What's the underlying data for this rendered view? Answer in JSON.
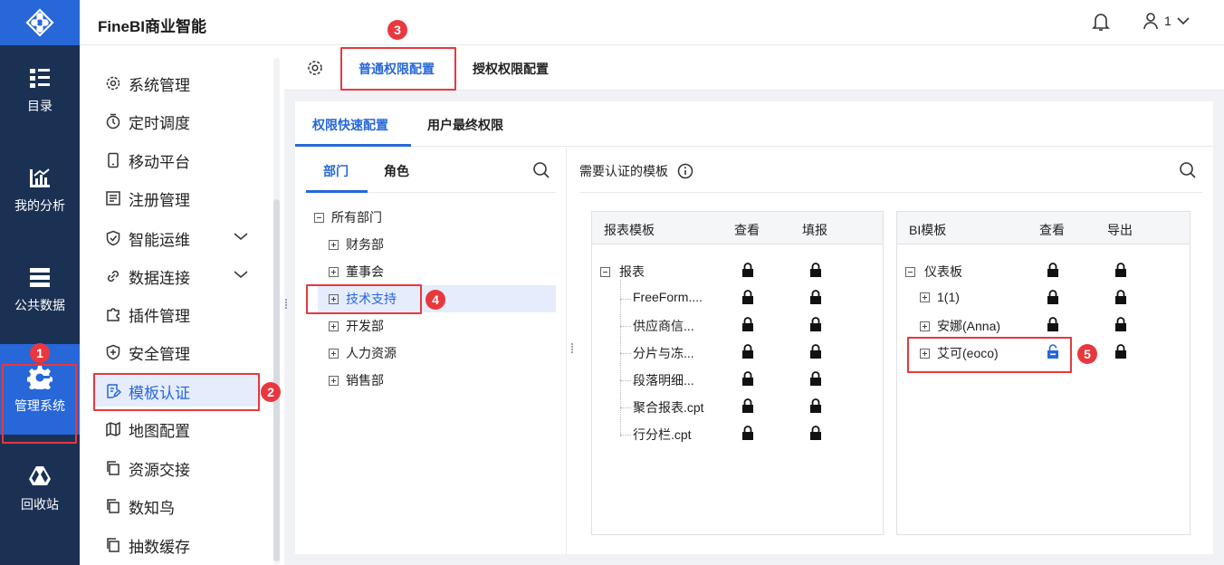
{
  "app": {
    "title": "FineBI商业智能"
  },
  "header": {
    "user_label": "1"
  },
  "rail": {
    "items": [
      {
        "label": "目录",
        "icon": "catalog-icon"
      },
      {
        "label": "我的分析",
        "icon": "analysis-icon"
      },
      {
        "label": "公共数据",
        "icon": "public-data-icon"
      },
      {
        "label": "管理系统",
        "icon": "manage-gear-icon"
      },
      {
        "label": "回收站",
        "icon": "recycle-icon"
      }
    ]
  },
  "menu": {
    "items": [
      {
        "label": "系统管理"
      },
      {
        "label": "定时调度"
      },
      {
        "label": "移动平台"
      },
      {
        "label": "注册管理"
      },
      {
        "label": "智能运维"
      },
      {
        "label": "数据连接"
      },
      {
        "label": "插件管理"
      },
      {
        "label": "安全管理"
      },
      {
        "label": "模板认证"
      },
      {
        "label": "地图配置"
      },
      {
        "label": "资源交接"
      },
      {
        "label": "数知鸟"
      },
      {
        "label": "抽数缓存"
      }
    ]
  },
  "top_tabs": {
    "general": "普通权限配置",
    "authorize": "授权权限配置"
  },
  "sub_tabs": {
    "quick": "权限快速配置",
    "final": "用户最终权限"
  },
  "left_pane": {
    "tab_dept": "部门",
    "tab_role": "角色",
    "root": "所有部门",
    "departments": [
      "财务部",
      "董事会",
      "技术支持",
      "开发部",
      "人力资源",
      "销售部"
    ]
  },
  "right_pane": {
    "title": "需要认证的模板",
    "report_table": {
      "col_name": "报表模板",
      "col_view": "查看",
      "col_fill": "填报",
      "root": "报表",
      "items": [
        "FreeForm....",
        "供应商信...",
        "分片与冻...",
        "段落明细...",
        "聚合报表.cpt",
        "行分栏.cpt"
      ]
    },
    "bi_table": {
      "col_name": "BI模板",
      "col_view": "查看",
      "col_export": "导出",
      "root": "仪表板",
      "items": [
        "1(1)",
        "安娜(Anna)",
        "艾可(eoco)"
      ]
    }
  },
  "steps": [
    "1",
    "2",
    "3",
    "4",
    "5"
  ],
  "colors": {
    "accent": "#2767d8",
    "rail_bg": "#1b3154",
    "highlight": "#e8383d"
  }
}
